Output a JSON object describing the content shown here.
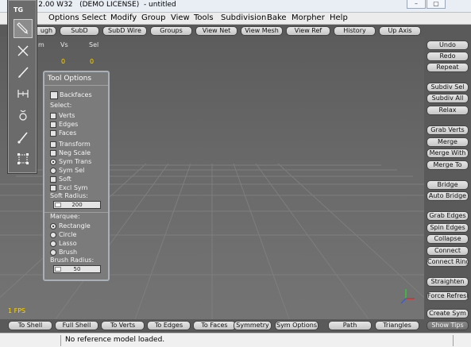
{
  "window": {
    "title": "un 2.00 W32   (DEMO LICENSE)  - untitled",
    "controls": [
      "–",
      "▢"
    ]
  },
  "menubar": [
    "Options",
    "Select",
    "Modify",
    "Group",
    "View",
    "Tools",
    "Subdivision",
    "Bake",
    "Morpher",
    "Help"
  ],
  "top_toolbar": [
    "ugh",
    "SubD",
    "SubD Wire",
    "Groups",
    "View Net",
    "View Mesh",
    "View Ref",
    "History",
    "Up Axis"
  ],
  "stats": {
    "headers": [
      "m",
      "Vs",
      "Sel"
    ],
    "values": [
      "0",
      "0"
    ]
  },
  "fps_label": "1 FPS",
  "tool_panel": {
    "title": "TG",
    "tools": [
      "brush-tool-icon",
      "move-tool-icon",
      "pencil-tool-icon",
      "measure-tool-icon",
      "smooth-tool-icon",
      "paint-brush-icon",
      "select-handles-icon"
    ]
  },
  "tool_options": {
    "title": "Tool Options",
    "backfaces": "Backfaces",
    "select_label": "Select:",
    "select_items": [
      "Verts",
      "Edges",
      "Faces"
    ],
    "options": [
      "Transform",
      "Neg Scale",
      "Sym Trans",
      "Sym Sel",
      "Soft",
      "Excl Sym"
    ],
    "soft_radius_label": "Soft Radius:",
    "soft_radius_value": "200",
    "marquee_label": "Marquee:",
    "marquee_items": [
      "Rectangle",
      "Circle",
      "Lasso",
      "Brush"
    ],
    "brush_radius_label": "Brush Radius:",
    "brush_radius_value": "50"
  },
  "side_toolbar": [
    "Undo",
    "Redo",
    "Repeat",
    "Subdiv Sel",
    "Subdiv All",
    "Relax",
    "Grab Verts",
    "Merge",
    "Merge With",
    "Merge To",
    "Bridge",
    "Auto Bridge",
    "Grab Edges",
    "Spin Edges",
    "Collapse",
    "Connect",
    "Connect Ring",
    "Straighten",
    "Force Refresh",
    "Create Sym",
    "Show Tips"
  ],
  "bottom_toolbar": [
    "To Shell",
    "Full Shell",
    "To Verts",
    "To Edges",
    "To Faces",
    "Symmetry",
    "Sym Options",
    "Path",
    "Triangles"
  ],
  "status": "No reference model loaded."
}
